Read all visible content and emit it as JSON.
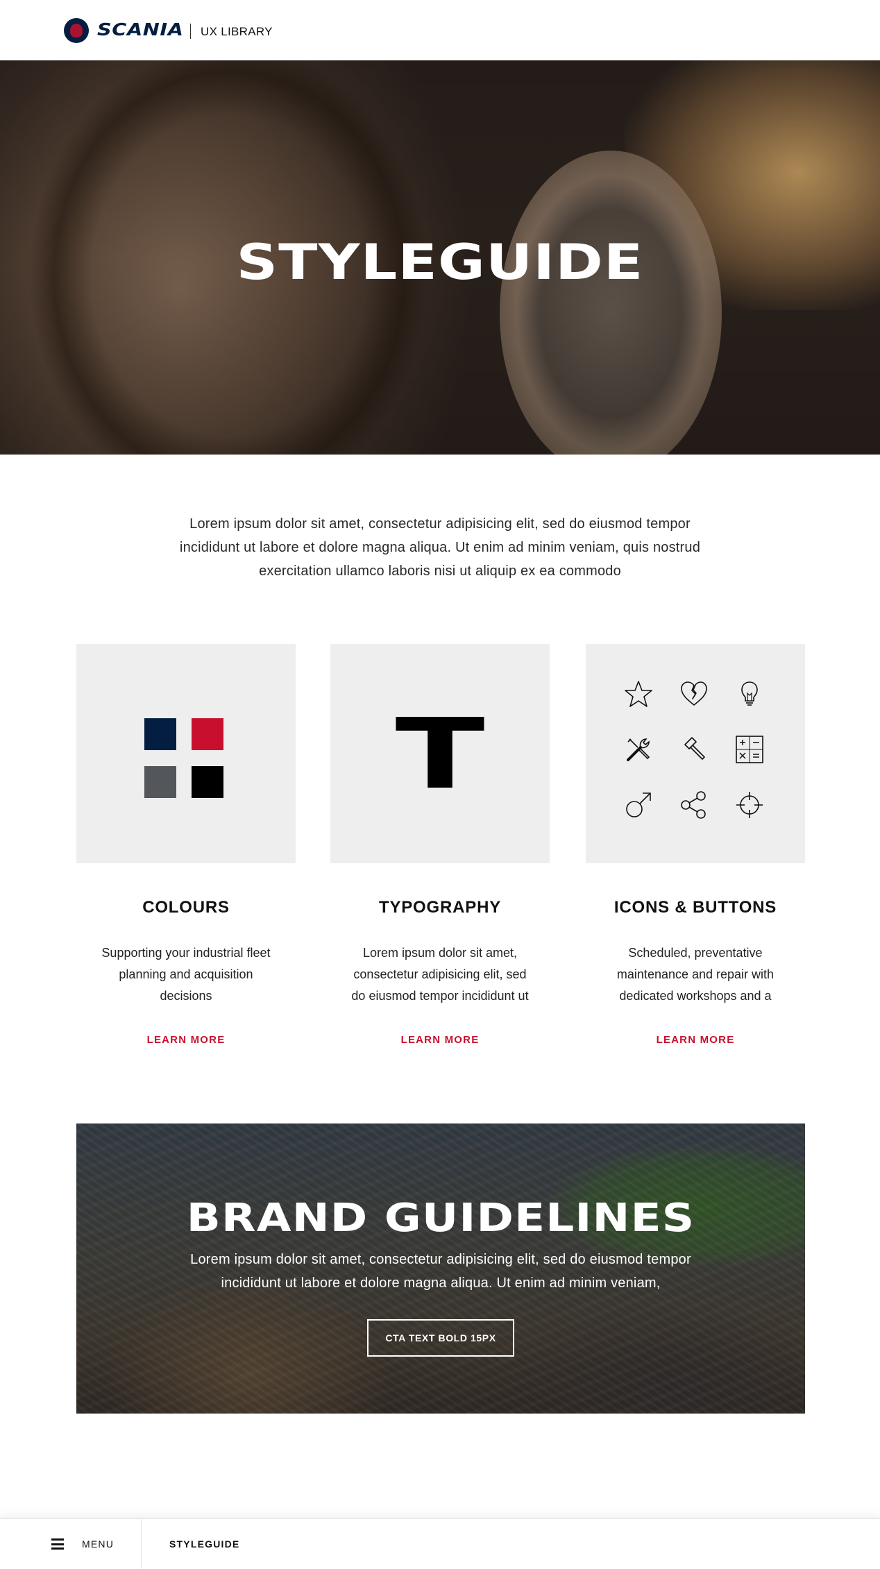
{
  "header": {
    "brand": "SCANIA",
    "sub_title": "UX LIBRARY"
  },
  "hero": {
    "title": "STYLEGUIDE"
  },
  "intro": {
    "text": "Lorem ipsum dolor sit amet, consectetur adipisicing elit, sed do eiusmod tempor incididunt ut labore et dolore magna aliqua. Ut enim ad minim veniam, quis nostrud exercitation ullamco laboris nisi ut aliquip ex ea commodo"
  },
  "cards": [
    {
      "title": "COLOURS",
      "text": "Supporting your industrial fleet planning and acquisition decisions",
      "link": "LEARN MORE",
      "swatches": [
        "#041e42",
        "#c8102e",
        "#53565a",
        "#000000"
      ]
    },
    {
      "title": "TYPOGRAPHY",
      "text": "Lorem ipsum dolor sit amet, consectetur adipisicing elit, sed do eiusmod tempor incididunt ut",
      "link": "LEARN MORE",
      "glyph": "T"
    },
    {
      "title": "ICONS & BUTTONS",
      "text": "Scheduled, preventative maintenance and repair with dedicated workshops and a",
      "link": "LEARN MORE",
      "icons": [
        "star-icon",
        "broken-heart-icon",
        "lightbulb-icon",
        "tools-icon",
        "hammer-icon",
        "calculator-icon",
        "male-icon",
        "share-icon",
        "crosshair-icon"
      ]
    }
  ],
  "banner": {
    "title": "BRAND GUIDELINES",
    "text": "Lorem ipsum dolor sit amet, consectetur adipisicing elit, sed do eiusmod tempor incididunt ut labore et dolore magna aliqua. Ut enim ad minim veniam,",
    "cta": "CTA TEXT BOLD 15PX"
  },
  "footer_bar": {
    "menu_label": "MENU",
    "breadcrumb": "STYLEGUIDE"
  },
  "colors": {
    "brand_blue": "#041e42",
    "brand_red": "#c8102e",
    "tile_grey": "#eeeeee"
  }
}
